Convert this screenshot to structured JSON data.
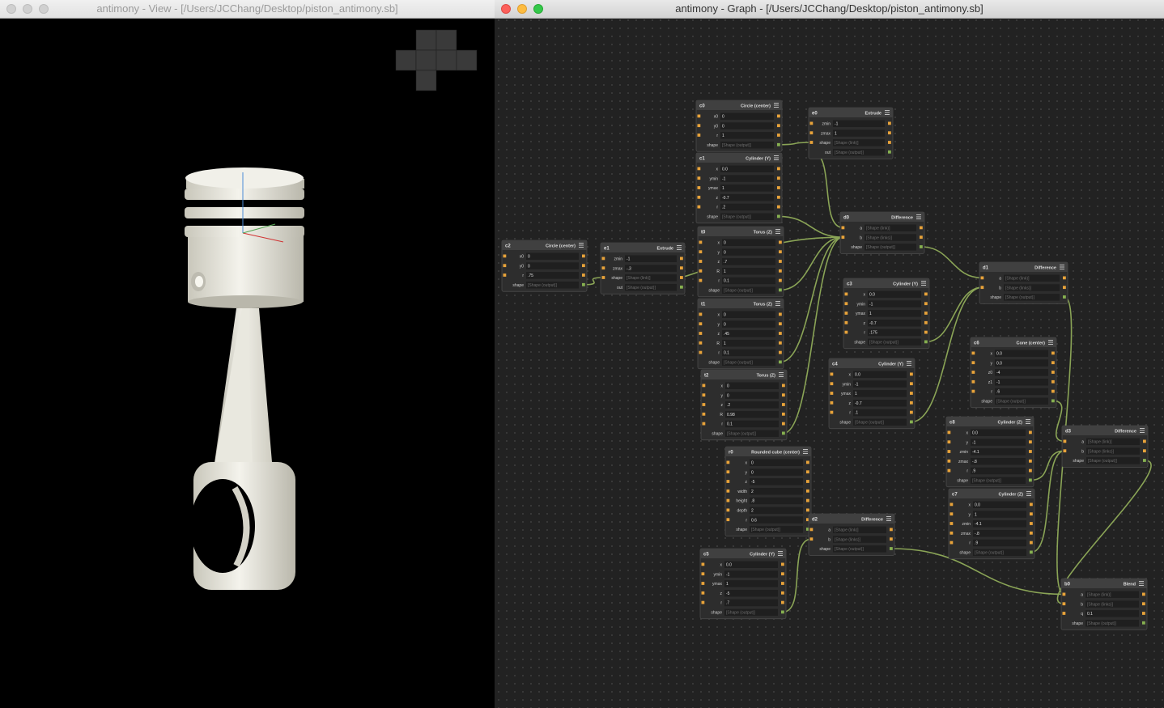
{
  "view_window": {
    "title": "antimony - View - [/Users/JCChang/Desktop/piston_antimony.sb]",
    "active": false
  },
  "graph_window": {
    "title": "antimony - Graph - [/Users/JCChang/Desktop/piston_antimony.sb]",
    "active": true
  },
  "colors": {
    "wire": "#8aa456",
    "port_input": "#e8a33a",
    "port_output": "#86b050",
    "node_header": "#404040",
    "node_body": "#2d2d2d",
    "field_bg": "#1f1f1f",
    "view_bg": "#000000",
    "piston": "#ecebe2"
  },
  "nodes": [
    {
      "id": "c0",
      "type": "Circle (center)",
      "fields": [
        [
          "x0",
          "0"
        ],
        [
          "y0",
          "0"
        ],
        [
          "r",
          "1"
        ],
        [
          "shape",
          "[Shape (output)]"
        ]
      ]
    },
    {
      "id": "e0",
      "type": "Extrude",
      "fields": [
        [
          "zmin",
          "-1"
        ],
        [
          "zmax",
          "1"
        ],
        [
          "shape",
          "[Shape (link)]"
        ],
        [
          "out",
          "[Shape (output)]"
        ]
      ]
    },
    {
      "id": "c1",
      "type": "Cylinder (Y)",
      "fields": [
        [
          "x",
          "0.0"
        ],
        [
          "ymin",
          "-1"
        ],
        [
          "ymax",
          "1"
        ],
        [
          "z",
          "-0.7"
        ],
        [
          "r",
          ".2"
        ],
        [
          "shape",
          "[Shape (output)]"
        ]
      ]
    },
    {
      "id": "d0",
      "type": "Difference",
      "fields": [
        [
          "a",
          "[Shape (link)]"
        ],
        [
          "b",
          "[Shape (links)]"
        ],
        [
          "shape",
          "[Shape (output)]"
        ]
      ]
    },
    {
      "id": "c2",
      "type": "Circle (center)",
      "fields": [
        [
          "x0",
          "0"
        ],
        [
          "y0",
          "0"
        ],
        [
          "r",
          ".75"
        ],
        [
          "shape",
          "[Shape (output)]"
        ]
      ]
    },
    {
      "id": "e1",
      "type": "Extrude",
      "fields": [
        [
          "zmin",
          "-1"
        ],
        [
          "zmax",
          "-.3"
        ],
        [
          "shape",
          "[Shape (link)]"
        ],
        [
          "out",
          "[Shape (output)]"
        ]
      ]
    },
    {
      "id": "t0",
      "type": "Torus (Z)",
      "fields": [
        [
          "x",
          "0"
        ],
        [
          "y",
          "0"
        ],
        [
          "z",
          ".7"
        ],
        [
          "R",
          "1"
        ],
        [
          "r",
          "0.1"
        ],
        [
          "shape",
          "[Shape (output)]"
        ]
      ]
    },
    {
      "id": "t1",
      "type": "Torus (Z)",
      "fields": [
        [
          "x",
          "0"
        ],
        [
          "y",
          "0"
        ],
        [
          "z",
          ".45"
        ],
        [
          "R",
          "1"
        ],
        [
          "r",
          "0.1"
        ],
        [
          "shape",
          "[Shape (output)]"
        ]
      ]
    },
    {
      "id": "t2",
      "type": "Torus (Z)",
      "fields": [
        [
          "x",
          "0"
        ],
        [
          "y",
          "0"
        ],
        [
          "z",
          ".2"
        ],
        [
          "R",
          "0.98"
        ],
        [
          "r",
          "0.1"
        ],
        [
          "shape",
          "[Shape (output)]"
        ]
      ]
    },
    {
      "id": "c3",
      "type": "Cylinder (Y)",
      "fields": [
        [
          "x",
          "0.0"
        ],
        [
          "ymin",
          "-1"
        ],
        [
          "ymax",
          "1"
        ],
        [
          "z",
          "-0.7"
        ],
        [
          "r",
          ".175"
        ],
        [
          "shape",
          "[Shape (output)]"
        ]
      ]
    },
    {
      "id": "c4",
      "type": "Cylinder (Y)",
      "fields": [
        [
          "x",
          "0.0"
        ],
        [
          "ymin",
          "-1"
        ],
        [
          "ymax",
          "1"
        ],
        [
          "z",
          "-0.7"
        ],
        [
          "r",
          ".1"
        ],
        [
          "shape",
          "[Shape (output)]"
        ]
      ]
    },
    {
      "id": "d1",
      "type": "Difference",
      "fields": [
        [
          "a",
          "[Shape (link)]"
        ],
        [
          "b",
          "[Shape (links)]"
        ],
        [
          "shape",
          "[Shape (output)]"
        ]
      ]
    },
    {
      "id": "c6",
      "type": "Cone (center)",
      "fields": [
        [
          "x",
          "0.0"
        ],
        [
          "y",
          "0.0"
        ],
        [
          "z0",
          "-4"
        ],
        [
          "z1",
          "-1"
        ],
        [
          "r",
          ".6"
        ],
        [
          "shape",
          "[Shape (output)]"
        ]
      ]
    },
    {
      "id": "c8",
      "type": "Cylinder (Z)",
      "fields": [
        [
          "x",
          "0.0"
        ],
        [
          "y",
          "-1"
        ],
        [
          "zmin",
          "-4.1"
        ],
        [
          "zmax",
          "-.8"
        ],
        [
          "r",
          ".9"
        ],
        [
          "shape",
          "[Shape (output)]"
        ]
      ]
    },
    {
      "id": "d3",
      "type": "Difference",
      "fields": [
        [
          "a",
          "[Shape (link)]"
        ],
        [
          "b",
          "[Shape (links)]"
        ],
        [
          "shape",
          "[Shape (output)]"
        ]
      ]
    },
    {
      "id": "r0",
      "type": "Rounded cube (center)",
      "fields": [
        [
          "x",
          "0"
        ],
        [
          "y",
          "0"
        ],
        [
          "z",
          "-5"
        ],
        [
          "width",
          "2"
        ],
        [
          "height",
          ".8"
        ],
        [
          "depth",
          "2"
        ],
        [
          "r",
          "0.6"
        ],
        [
          "shape",
          "[Shape (output)]"
        ]
      ]
    },
    {
      "id": "d2",
      "type": "Difference",
      "fields": [
        [
          "a",
          "[Shape (link)]"
        ],
        [
          "b",
          "[Shape (links)]"
        ],
        [
          "shape",
          "[Shape (output)]"
        ]
      ]
    },
    {
      "id": "c7",
      "type": "Cylinder (Z)",
      "fields": [
        [
          "x",
          "0.0"
        ],
        [
          "y",
          "1"
        ],
        [
          "zmin",
          "-4.1"
        ],
        [
          "zmax",
          "-.8"
        ],
        [
          "r",
          ".9"
        ],
        [
          "shape",
          "[Shape (output)]"
        ]
      ]
    },
    {
      "id": "c5",
      "type": "Cylinder (Y)",
      "fields": [
        [
          "x",
          "0.0"
        ],
        [
          "ymin",
          "-1"
        ],
        [
          "ymax",
          "1"
        ],
        [
          "z",
          "-5"
        ],
        [
          "r",
          ".7"
        ],
        [
          "shape",
          "[Shape (output)]"
        ]
      ]
    },
    {
      "id": "b0",
      "type": "Blend",
      "fields": [
        [
          "a",
          "[Shape (link)]"
        ],
        [
          "b",
          "[Shape (links)]"
        ],
        [
          "q",
          "0.1"
        ],
        [
          "shape",
          "[Shape (output)]"
        ]
      ]
    }
  ]
}
